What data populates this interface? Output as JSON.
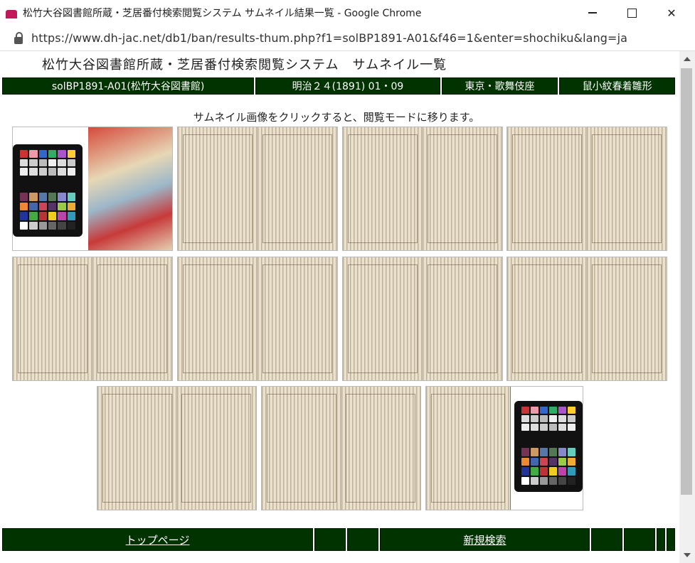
{
  "window": {
    "title": "松竹大谷図書館所蔵・芝居番付検索閲覧システム サムネイル結果一覧 - Google Chrome",
    "url": "https://www.dh-jac.net/db1/ban/results-thum.php?f1=solBP1891-A01&f46=1&enter=shochiku&lang=ja"
  },
  "page": {
    "title": "松竹大谷図書館所蔵・芝居番付検索閲覧システム　サムネイル一覧",
    "info": {
      "id": "solBP1891-A01(松竹大谷図書館)",
      "date": "明治２４(1891) 01・09",
      "venue": "東京・歌舞伎座",
      "play": "鼠小紋春着雛形"
    },
    "instruction": "サムネイル画像をクリックすると、閲覧モードに移ります。"
  },
  "thumbnails": [
    {
      "kind": "cover"
    },
    {
      "kind": "pages"
    },
    {
      "kind": "pages"
    },
    {
      "kind": "pages"
    },
    {
      "kind": "pages"
    },
    {
      "kind": "pages"
    },
    {
      "kind": "pages"
    },
    {
      "kind": "pages"
    },
    {
      "kind": "pages"
    },
    {
      "kind": "pages"
    },
    {
      "kind": "back"
    }
  ],
  "footer": {
    "top_label": "トップページ",
    "new_search_label": "新規検索"
  }
}
